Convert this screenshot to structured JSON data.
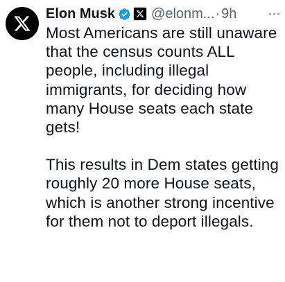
{
  "author": {
    "name": "Elon Musk",
    "handle": "@elonm...",
    "separator": "·",
    "time": "9h",
    "avatar_icon": "x-logo-icon",
    "verified_color": "#1d9bf0"
  },
  "tweet": {
    "paragraph1": "Most Americans are still unaware that the census counts ALL people, including illegal immigrants, for deciding how many House seats each state gets!",
    "paragraph2": "This results in Dem states getting roughly 20 more House seats, which is another strong incentive for them not to deport illegals."
  },
  "colors": {
    "text": "#0f1419",
    "secondary": "#536471",
    "avatar_bg": "#000000"
  }
}
